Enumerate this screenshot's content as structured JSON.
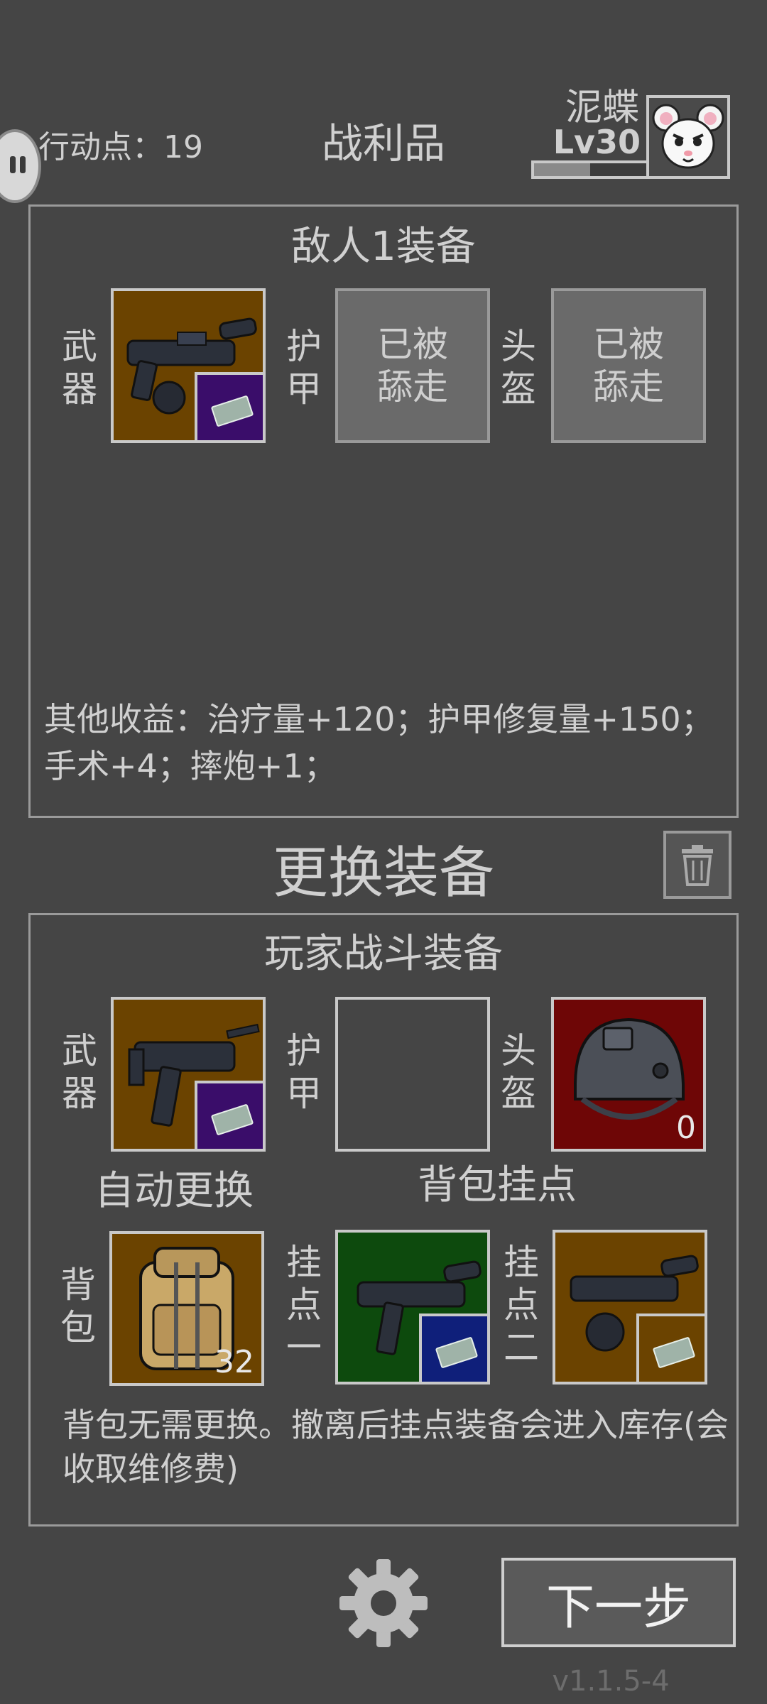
{
  "header": {
    "action_points": "行动点：19",
    "title": "战利品",
    "player_name": "泥蝶",
    "player_level": "Lv30",
    "xp_fraction": 0.5
  },
  "enemy": {
    "title": "敌人1装备",
    "weapon_label": "武器",
    "armor_label": "护甲",
    "helmet_label": "头盔",
    "armor_status": "已被舔走",
    "helmet_status": "已被舔走",
    "other_income": "其他收益：治疗量+120；护甲修复量+150；手术+4；摔炮+1；"
  },
  "change": {
    "title": "更换装备"
  },
  "player": {
    "title": "玩家战斗装备",
    "weapon_label": "武器",
    "armor_label": "护甲",
    "helmet_label": "头盔",
    "helmet_count": "0",
    "auto_label": "自动更换",
    "backpack_mounts_label": "背包挂点",
    "backpack_label": "背包",
    "backpack_count": "32",
    "mount1_label": "挂点一",
    "mount2_label": "挂点二",
    "note": "背包无需更换。撤离后挂点装备会进入库存(会收取维修费)"
  },
  "footer": {
    "next_label": "下一步",
    "version": "v1.1.5-4"
  },
  "colors": {
    "background": "#454545",
    "slot_brown": "#6b4300",
    "slot_purple": "#3a0d6a",
    "slot_green": "#0d4a0d",
    "slot_blue": "#0f1f7a",
    "slot_red": "#6e0606",
    "taken_gray": "#6a6a6a"
  },
  "icons": [
    "pause-icon",
    "avatar-mouse-icon",
    "trash-icon",
    "gear-icon",
    "rifle-icon",
    "ammo-icon",
    "helmet-icon",
    "backpack-icon"
  ]
}
